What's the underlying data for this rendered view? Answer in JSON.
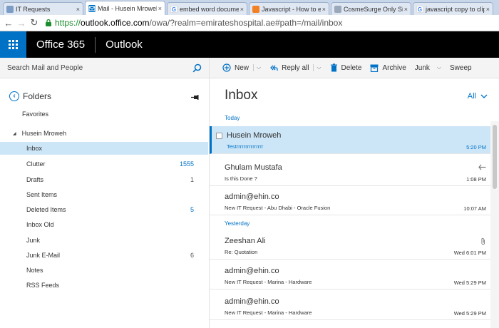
{
  "browser": {
    "tabs": [
      {
        "title": "IT Requests",
        "icon": "page-icon",
        "color": "#7a9cc6",
        "active": false
      },
      {
        "title": "Mail - Husein Mroweh",
        "icon": "mail-icon",
        "color": "#0072c6",
        "active": true
      },
      {
        "title": "embed word documen",
        "icon": "google-icon",
        "color": "#4285f4",
        "active": false
      },
      {
        "title": "Javascript - How to e",
        "icon": "stack-icon",
        "color": "#f48024",
        "active": false
      },
      {
        "title": "CosmeSurge Only Sig",
        "icon": "page-icon",
        "color": "#9aa8ba",
        "active": false
      },
      {
        "title": "javascript copy to clip",
        "icon": "google-icon",
        "color": "#4285f4",
        "active": false
      }
    ],
    "tab_close": "×",
    "url_scheme": "https://",
    "url_host": "outlook.office.com",
    "url_path": "/owa/?realm=emirateshospital.ae#path=/mail/inbox"
  },
  "header": {
    "brand": "Office 365",
    "app": "Outlook"
  },
  "search": {
    "placeholder": "Search Mail and People"
  },
  "commands": {
    "new": "New",
    "reply_all": "Reply all",
    "delete": "Delete",
    "archive": "Archive",
    "junk": "Junk",
    "sweep": "Sweep"
  },
  "folders": {
    "title": "Folders",
    "favorites": "Favorites",
    "account": "Husein Mroweh",
    "items": [
      {
        "name": "Inbox",
        "count": "",
        "selected": true
      },
      {
        "name": "Clutter",
        "count": "1555",
        "count_color": "blue"
      },
      {
        "name": "Drafts",
        "count": "1",
        "count_color": "grey"
      },
      {
        "name": "Sent Items",
        "count": ""
      },
      {
        "name": "Deleted Items",
        "count": "5",
        "count_color": "blue"
      },
      {
        "name": "Inbox Old",
        "count": ""
      },
      {
        "name": "Junk",
        "count": ""
      },
      {
        "name": "Junk E-Mail",
        "count": "6",
        "count_color": "grey"
      },
      {
        "name": "Notes",
        "count": ""
      },
      {
        "name": "RSS Feeds",
        "count": ""
      }
    ]
  },
  "list": {
    "title": "Inbox",
    "filter": "All",
    "groups": {
      "today": "Today",
      "yesterday": "Yesterday"
    },
    "messages": [
      {
        "sender": "Husein Mroweh",
        "subject": "Testrrrrrrrrrrrrrrr",
        "time": "5:20 PM",
        "selected": true
      },
      {
        "sender": "Ghulam Mustafa",
        "subject": "Is this Done ?",
        "time": "1:08 PM",
        "icon": "reply-arrow-icon"
      },
      {
        "sender": "admin@ehin.co",
        "subject": "New IT Request - Abu Dhabi - Oracle Fusion",
        "time": "10:07 AM"
      },
      {
        "sender": "Zeeshan Ali",
        "subject": "Re: Quotation",
        "time": "Wed 6:01 PM",
        "icon": "paperclip-icon"
      },
      {
        "sender": "admin@ehin.co",
        "subject": "New IT Request - Marina - Hardware",
        "time": "Wed 5:29 PM"
      },
      {
        "sender": "admin@ehin.co",
        "subject": "New IT Request - Marina - Hardware",
        "time": "Wed 5:29 PM"
      }
    ]
  },
  "colors": {
    "accent": "#0072c6",
    "selected_bg": "#cde6f7"
  }
}
